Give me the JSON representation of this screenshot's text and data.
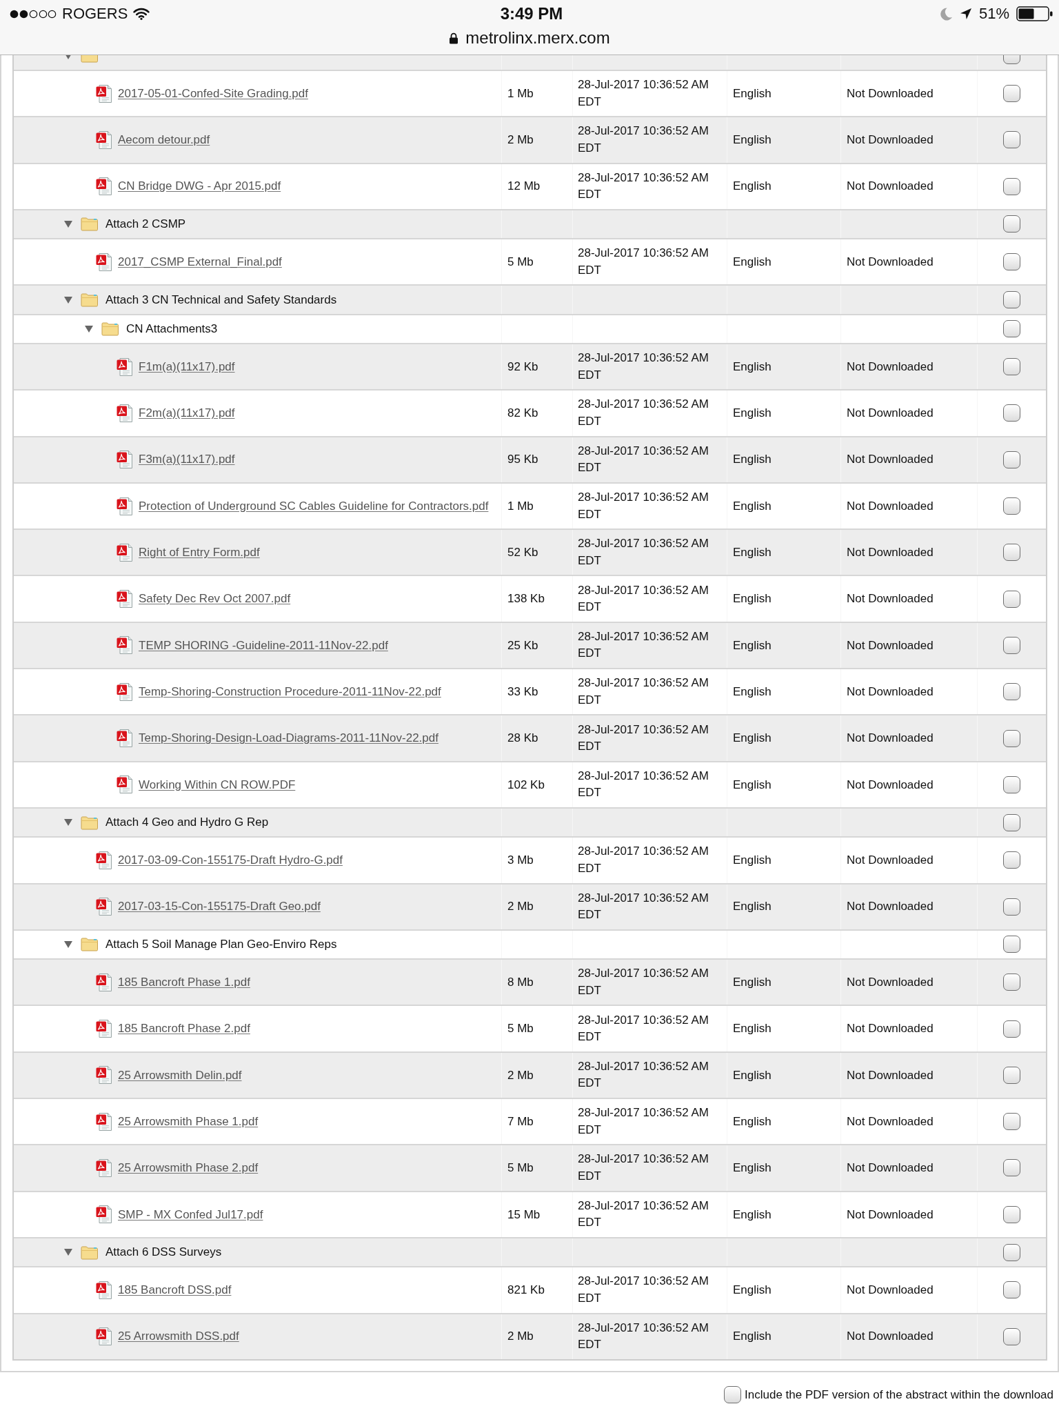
{
  "status_bar": {
    "carrier": "ROGERS",
    "time": "3:49 PM",
    "battery_percent": "51%",
    "url": "metrolinx.merx.com"
  },
  "file_tree": [
    {
      "kind": "folder",
      "expanded": true,
      "checked": false,
      "children": [
        {
          "kind": "file",
          "name": "2017-05-01-Confed-Site Grading.pdf",
          "size": "1 Mb",
          "date": "28-Jul-2017 10:36:52 AM EDT",
          "language": "English",
          "status": "Not Downloaded",
          "checked": false
        },
        {
          "kind": "file",
          "name": "Aecom detour.pdf",
          "size": "2 Mb",
          "date": "28-Jul-2017 10:36:52 AM EDT",
          "language": "English",
          "status": "Not Downloaded",
          "checked": false
        },
        {
          "kind": "file",
          "name": "CN Bridge DWG - Apr 2015.pdf",
          "size": "12 Mb",
          "date": "28-Jul-2017 10:36:52 AM EDT",
          "language": "English",
          "status": "Not Downloaded",
          "checked": false
        }
      ]
    },
    {
      "kind": "folder",
      "name": "Attach 2 CSMP",
      "expanded": true,
      "checked": false,
      "children": [
        {
          "kind": "file",
          "name": "2017_CSMP External_Final.pdf",
          "size": "5 Mb",
          "date": "28-Jul-2017 10:36:52 AM EDT",
          "language": "English",
          "status": "Not Downloaded",
          "checked": false
        }
      ]
    },
    {
      "kind": "folder",
      "name": "Attach 3 CN Technical and Safety Standards",
      "expanded": true,
      "checked": false,
      "children": [
        {
          "kind": "folder",
          "name": "CN Attachments3",
          "expanded": true,
          "checked": false,
          "children": [
            {
              "kind": "file",
              "name": "F1m(a)(11x17).pdf",
              "size": "92 Kb",
              "date": "28-Jul-2017 10:36:52 AM EDT",
              "language": "English",
              "status": "Not Downloaded",
              "checked": false
            },
            {
              "kind": "file",
              "name": "F2m(a)(11x17).pdf",
              "size": "82 Kb",
              "date": "28-Jul-2017 10:36:52 AM EDT",
              "language": "English",
              "status": "Not Downloaded",
              "checked": false
            },
            {
              "kind": "file",
              "name": "F3m(a)(11x17).pdf",
              "size": "95 Kb",
              "date": "28-Jul-2017 10:36:52 AM EDT",
              "language": "English",
              "status": "Not Downloaded",
              "checked": false
            },
            {
              "kind": "file",
              "name": "Protection of Underground SC Cables Guideline for Contractors.pdf",
              "size": "1 Mb",
              "date": "28-Jul-2017 10:36:52 AM EDT",
              "language": "English",
              "status": "Not Downloaded",
              "checked": false
            },
            {
              "kind": "file",
              "name": "Right of Entry Form.pdf",
              "size": "52 Kb",
              "date": "28-Jul-2017 10:36:52 AM EDT",
              "language": "English",
              "status": "Not Downloaded",
              "checked": false
            },
            {
              "kind": "file",
              "name": "Safety Dec Rev Oct 2007.pdf",
              "size": "138 Kb",
              "date": "28-Jul-2017 10:36:52 AM EDT",
              "language": "English",
              "status": "Not Downloaded",
              "checked": false
            },
            {
              "kind": "file",
              "name": "TEMP SHORING -Guideline-2011-11Nov-22.pdf",
              "size": "25 Kb",
              "date": "28-Jul-2017 10:36:52 AM EDT",
              "language": "English",
              "status": "Not Downloaded",
              "checked": false
            },
            {
              "kind": "file",
              "name": "Temp-Shoring-Construction Procedure-2011-11Nov-22.pdf",
              "size": "33 Kb",
              "date": "28-Jul-2017 10:36:52 AM EDT",
              "language": "English",
              "status": "Not Downloaded",
              "checked": false
            },
            {
              "kind": "file",
              "name": "Temp-Shoring-Design-Load-Diagrams-2011-11Nov-22.pdf",
              "size": "28 Kb",
              "date": "28-Jul-2017 10:36:52 AM EDT",
              "language": "English",
              "status": "Not Downloaded",
              "checked": false
            },
            {
              "kind": "file",
              "name": "Working Within CN ROW.PDF",
              "size": "102 Kb",
              "date": "28-Jul-2017 10:36:52 AM EDT",
              "language": "English",
              "status": "Not Downloaded",
              "checked": false
            }
          ]
        }
      ]
    },
    {
      "kind": "folder",
      "name": "Attach 4 Geo and Hydro G Rep",
      "expanded": true,
      "checked": false,
      "children": [
        {
          "kind": "file",
          "name": "2017-03-09-Con-155175-Draft Hydro-G.pdf",
          "size": "3 Mb",
          "date": "28-Jul-2017 10:36:52 AM EDT",
          "language": "English",
          "status": "Not Downloaded",
          "checked": false
        },
        {
          "kind": "file",
          "name": "2017-03-15-Con-155175-Draft Geo.pdf",
          "size": "2 Mb",
          "date": "28-Jul-2017 10:36:52 AM EDT",
          "language": "English",
          "status": "Not Downloaded",
          "checked": false
        }
      ]
    },
    {
      "kind": "folder",
      "name": "Attach 5 Soil Manage Plan Geo-Enviro Reps",
      "expanded": true,
      "checked": false,
      "children": [
        {
          "kind": "file",
          "name": "185 Bancroft Phase 1.pdf",
          "size": "8 Mb",
          "date": "28-Jul-2017 10:36:52 AM EDT",
          "language": "English",
          "status": "Not Downloaded",
          "checked": false
        },
        {
          "kind": "file",
          "name": "185 Bancroft Phase 2.pdf",
          "size": "5 Mb",
          "date": "28-Jul-2017 10:36:52 AM EDT",
          "language": "English",
          "status": "Not Downloaded",
          "checked": false
        },
        {
          "kind": "file",
          "name": "25 Arrowsmith Delin.pdf",
          "size": "2 Mb",
          "date": "28-Jul-2017 10:36:52 AM EDT",
          "language": "English",
          "status": "Not Downloaded",
          "checked": false
        },
        {
          "kind": "file",
          "name": "25 Arrowsmith Phase 1.pdf",
          "size": "7 Mb",
          "date": "28-Jul-2017 10:36:52 AM EDT",
          "language": "English",
          "status": "Not Downloaded",
          "checked": false
        },
        {
          "kind": "file",
          "name": "25 Arrowsmith Phase 2.pdf",
          "size": "5 Mb",
          "date": "28-Jul-2017 10:36:52 AM EDT",
          "language": "English",
          "status": "Not Downloaded",
          "checked": false
        },
        {
          "kind": "file",
          "name": "SMP - MX Confed Jul17.pdf",
          "size": "15 Mb",
          "date": "28-Jul-2017 10:36:52 AM EDT",
          "language": "English",
          "status": "Not Downloaded",
          "checked": false
        }
      ]
    },
    {
      "kind": "folder",
      "name": "Attach 6 DSS Surveys",
      "expanded": true,
      "checked": false,
      "children": [
        {
          "kind": "file",
          "name": "185 Bancroft DSS.pdf",
          "size": "821 Kb",
          "date": "28-Jul-2017 10:36:52 AM EDT",
          "language": "English",
          "status": "Not Downloaded",
          "checked": false
        },
        {
          "kind": "file",
          "name": "25 Arrowsmith DSS.pdf",
          "size": "2 Mb",
          "date": "28-Jul-2017 10:36:52 AM EDT",
          "language": "English",
          "status": "Not Downloaded",
          "checked": false
        }
      ]
    }
  ],
  "footer": {
    "label": "Include the PDF version of the abstract within the download",
    "checked": false
  }
}
